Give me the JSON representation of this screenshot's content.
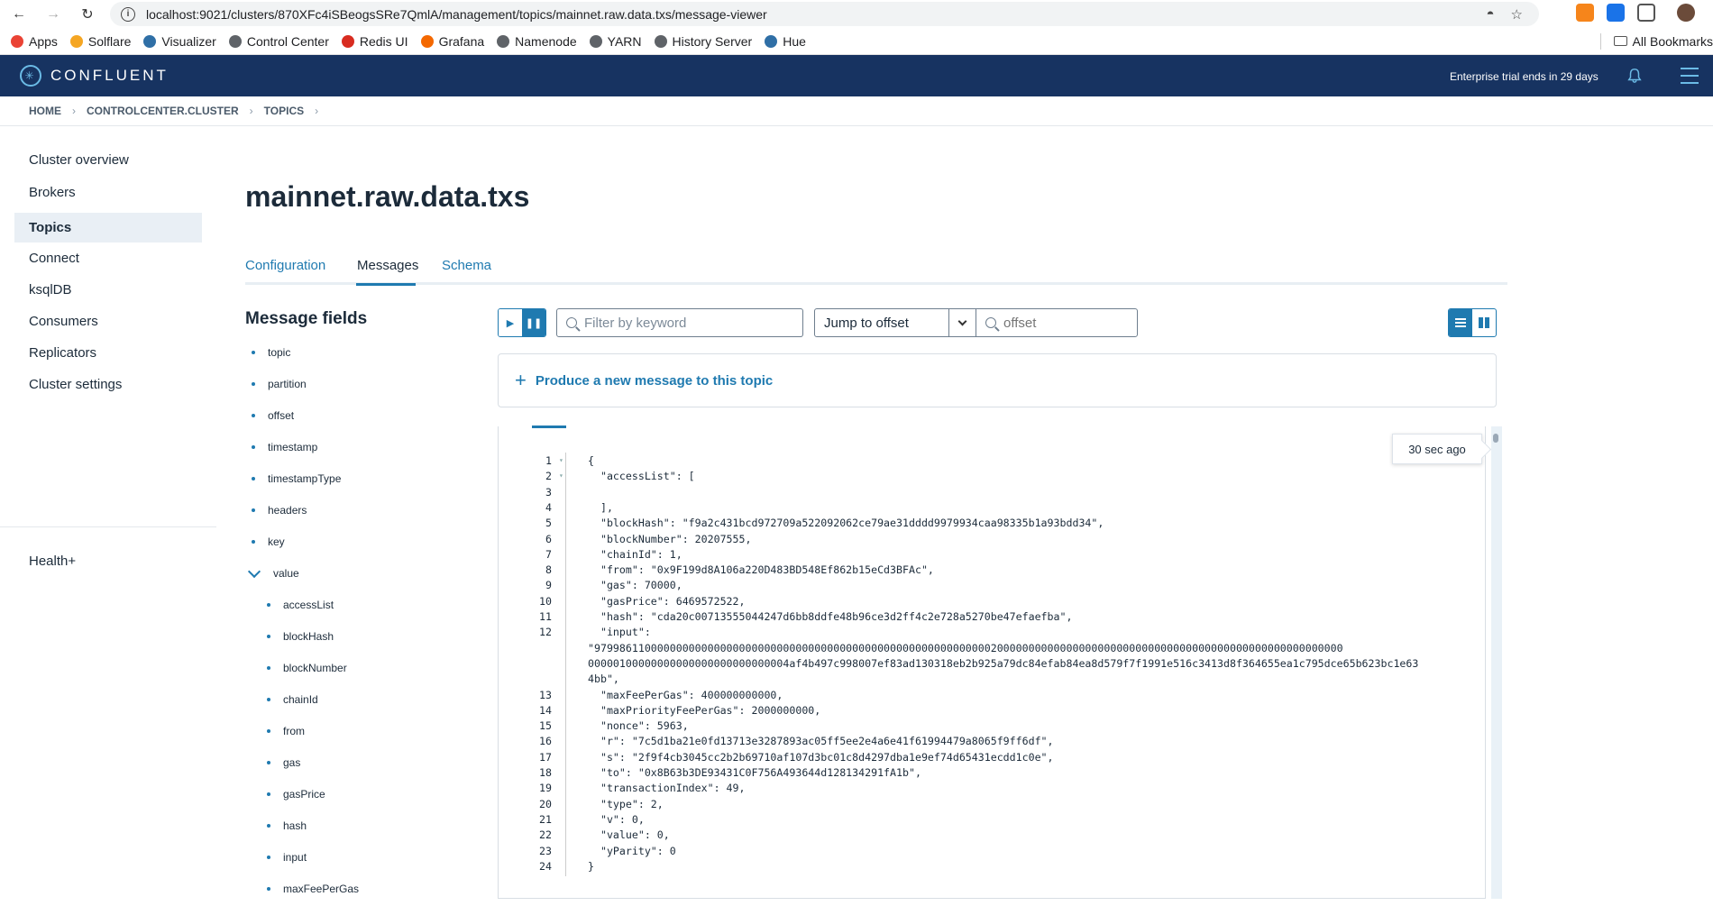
{
  "browser": {
    "url": "localhost:9021/clusters/870XFc4iSBeogsSRe7QmlA/management/topics/mainnet.raw.data.txs/message-viewer",
    "bookmarks": [
      {
        "label": "Apps",
        "color": "#ea4335"
      },
      {
        "label": "Solflare",
        "color": "#f5a623"
      },
      {
        "label": "Visualizer",
        "color": "#2f6fa6"
      },
      {
        "label": "Control Center",
        "color": "#5f6368"
      },
      {
        "label": "Redis UI",
        "color": "#d82c20"
      },
      {
        "label": "Grafana",
        "color": "#f46800"
      },
      {
        "label": "Namenode",
        "color": "#5f6368"
      },
      {
        "label": "YARN",
        "color": "#5f6368"
      },
      {
        "label": "History Server",
        "color": "#5f6368"
      },
      {
        "label": "Hue",
        "color": "#2f6fa6"
      }
    ],
    "all_bookmarks": "All Bookmarks"
  },
  "header": {
    "brand": "CONFLUENT",
    "trial_text": "Enterprise trial ends in 29 days",
    "brand_color": "#173361",
    "accent": "#1f7ab0"
  },
  "breadcrumb": [
    "HOME",
    "CONTROLCENTER.CLUSTER",
    "TOPICS"
  ],
  "sidebar": {
    "items": [
      {
        "label": "Cluster overview",
        "active": false
      },
      {
        "label": "Brokers",
        "active": false
      },
      {
        "label": "Topics",
        "active": true
      },
      {
        "label": "Connect",
        "active": false
      },
      {
        "label": "ksqlDB",
        "active": false
      },
      {
        "label": "Consumers",
        "active": false
      },
      {
        "label": "Replicators",
        "active": false
      },
      {
        "label": "Cluster settings",
        "active": false
      }
    ],
    "health": "Health+"
  },
  "page": {
    "title": "mainnet.raw.data.txs",
    "tabs": [
      {
        "label": "Configuration",
        "active": false
      },
      {
        "label": "Messages",
        "active": true
      },
      {
        "label": "Schema",
        "active": false
      }
    ]
  },
  "message_fields": {
    "title": "Message fields",
    "top": [
      "topic",
      "partition",
      "offset",
      "timestamp",
      "timestampType",
      "headers",
      "key"
    ],
    "value_label": "value",
    "value_children": [
      "accessList",
      "blockHash",
      "blockNumber",
      "chainId",
      "from",
      "gas",
      "gasPrice",
      "hash",
      "input",
      "maxFeePerGas"
    ]
  },
  "toolbar": {
    "filter_placeholder": "Filter by keyword",
    "jump_label": "Jump to offset",
    "offset_placeholder": "offset",
    "produce_label": "Produce a new message to this topic"
  },
  "message": {
    "time_ago": "30 sec ago",
    "lines": [
      {
        "n": "1",
        "text": "{"
      },
      {
        "n": "2",
        "text": "  \"accessList\": ["
      },
      {
        "n": "3",
        "text": ""
      },
      {
        "n": "4",
        "text": "  ],"
      },
      {
        "n": "5",
        "text": "  \"blockHash\": \"f9a2c431bcd972709a522092062ce79ae31dddd9979934caa98335b1a93bdd34\","
      },
      {
        "n": "6",
        "text": "  \"blockNumber\": 20207555,"
      },
      {
        "n": "7",
        "text": "  \"chainId\": 1,"
      },
      {
        "n": "8",
        "text": "  \"from\": \"0x9F199d8A106a220D483BD548Ef862b15eCd3BFAc\","
      },
      {
        "n": "9",
        "text": "  \"gas\": 70000,"
      },
      {
        "n": "10",
        "text": "  \"gasPrice\": 6469572522,"
      },
      {
        "n": "11",
        "text": "  \"hash\": \"cda20c00713555044247d6bb8ddfe48b96ce3d2ff4c2e728a5270be47efaefba\","
      },
      {
        "n": "12",
        "text": "  \"input\":"
      },
      {
        "n": "",
        "text": "\"97998611000000000000000000000000000000000000000000000000000000020000000000000000000000000000000000000000000000000000000"
      },
      {
        "n": "",
        "text": "00000100000000000000000000000004af4b497c998007ef83ad130318eb2b925a79dc84efab84ea8d579f7f1991e516c3413d8f364655ea1c795dce65b623bc1e63"
      },
      {
        "n": "",
        "text": "4bb\","
      },
      {
        "n": "13",
        "text": "  \"maxFeePerGas\": 400000000000,"
      },
      {
        "n": "14",
        "text": "  \"maxPriorityFeePerGas\": 2000000000,"
      },
      {
        "n": "15",
        "text": "  \"nonce\": 5963,"
      },
      {
        "n": "16",
        "text": "  \"r\": \"7c5d1ba21e0fd13713e3287893ac05ff5ee2e4a6e41f61994479a8065f9ff6df\","
      },
      {
        "n": "17",
        "text": "  \"s\": \"2f9f4cb3045cc2b2b69710af107d3bc01c8d4297dba1e9ef74d65431ecdd1c0e\","
      },
      {
        "n": "18",
        "text": "  \"to\": \"0x8B63b3DE93431C0F756A493644d128134291fA1b\","
      },
      {
        "n": "19",
        "text": "  \"transactionIndex\": 49,"
      },
      {
        "n": "20",
        "text": "  \"type\": 2,"
      },
      {
        "n": "21",
        "text": "  \"v\": 0,"
      },
      {
        "n": "22",
        "text": "  \"value\": 0,"
      },
      {
        "n": "23",
        "text": "  \"yParity\": 0"
      },
      {
        "n": "24",
        "text": "}"
      }
    ]
  }
}
